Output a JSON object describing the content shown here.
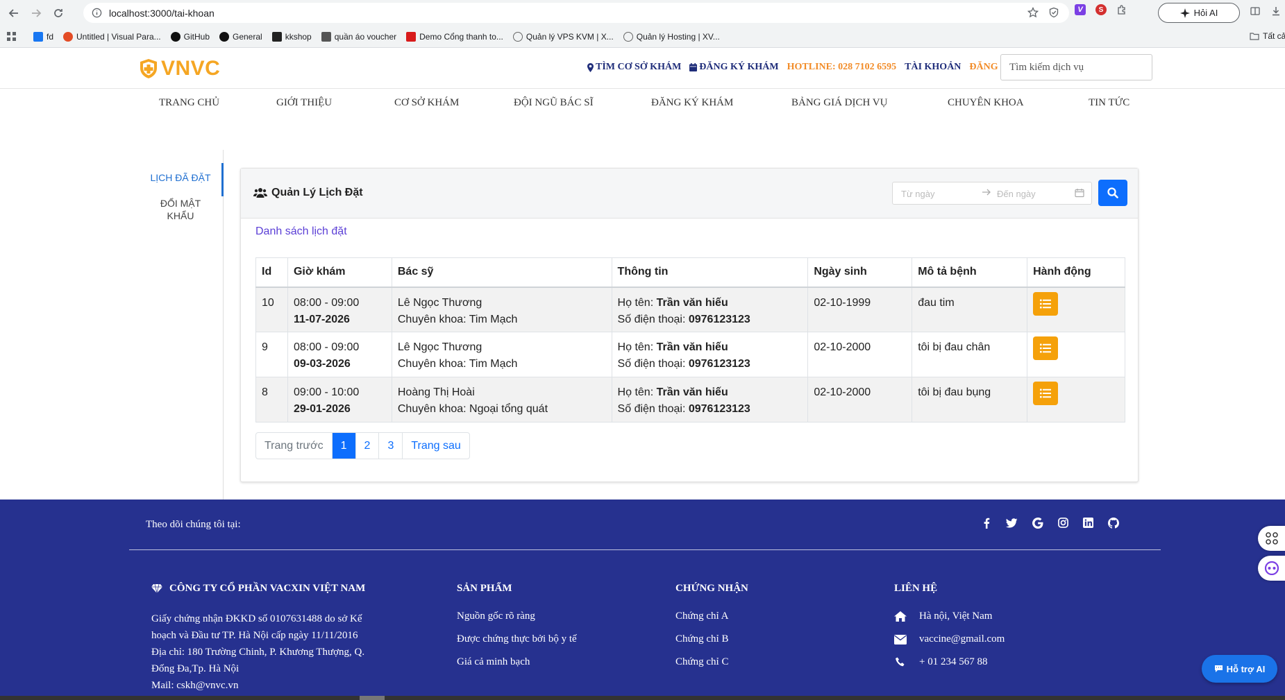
{
  "browser": {
    "url": "localhost:3000/tai-khoan",
    "ask_ai_label": "Hỏi AI",
    "all_bookmarks_label": "Tất cả",
    "bookmarks": [
      {
        "label": "fd",
        "icon": "facebook-icon",
        "color": "#1877f2"
      },
      {
        "label": "Untitled | Visual Para...",
        "icon": "visual-paradigm-icon",
        "color": "#e34c26"
      },
      {
        "label": "GitHub",
        "icon": "github-icon",
        "color": "#111111"
      },
      {
        "label": "General",
        "icon": "github-icon",
        "color": "#111111"
      },
      {
        "label": "kkshop",
        "icon": "kkshop-icon",
        "color": "#222222"
      },
      {
        "label": "quần áo voucher",
        "icon": "voucher-icon",
        "color": "#555555"
      },
      {
        "label": "Demo Cổng thanh to...",
        "icon": "vnpay-icon",
        "color": "#d81b1b"
      },
      {
        "label": "Quản lý VPS KVM | X...",
        "icon": "user-icon",
        "color": "#666666"
      },
      {
        "label": "Quản lý Hosting | XV...",
        "icon": "user-icon",
        "color": "#666666"
      }
    ]
  },
  "header": {
    "logo_text": "VNVC",
    "links": [
      {
        "label": "TÌM CƠ SỞ KHÁM",
        "style": "dark",
        "icon": "map-marker-icon"
      },
      {
        "label": "ĐĂNG KÝ KHÁM",
        "style": "dark",
        "icon": "calendar-icon"
      },
      {
        "label": "HOTLINE: 028 7102 6595",
        "style": "orange"
      },
      {
        "label": "TÀI KHOẢN",
        "style": "dark"
      },
      {
        "label": "ĐĂNG XUẤT",
        "style": "orange"
      }
    ],
    "search_placeholder": "Tìm kiếm dịch vụ"
  },
  "nav": [
    "TRANG CHỦ",
    "GIỚI THIỆU",
    "CƠ SỞ KHÁM",
    "ĐỘI NGŨ BÁC SĨ",
    "ĐĂNG KÝ KHÁM",
    "BẢNG GIÁ DỊCH VỤ",
    "CHUYÊN KHOA",
    "TIN TỨC"
  ],
  "sidebar": {
    "items": [
      "LỊCH ĐÃ ĐẶT",
      "ĐỔI MẬT KHẨU"
    ]
  },
  "card": {
    "title": "Quản Lý Lịch Đặt",
    "from_placeholder": "Từ ngày",
    "to_placeholder": "Đến ngày",
    "list_title": "Danh sách lịch đặt",
    "columns": [
      "Id",
      "Giờ khám",
      "Bác sỹ",
      "Thông tin",
      "Ngày sinh",
      "Mô tả bệnh",
      "Hành động"
    ],
    "name_prefix": "Họ tên: ",
    "phone_prefix": "Số điện thoại: ",
    "specialty_prefix": "Chuyên khoa: ",
    "rows": [
      {
        "id": "10",
        "time": "08:00 - 09:00",
        "date": "11-07-2026",
        "doctor": "Lê Ngọc Thương",
        "specialty": "Tim Mạch",
        "name": "Trần văn hiếu",
        "phone": "0976123123",
        "dob": "02-10-1999",
        "desc": "đau tim"
      },
      {
        "id": "9",
        "time": "08:00 - 09:00",
        "date": "09-03-2026",
        "doctor": "Lê Ngọc Thương",
        "specialty": "Tim Mạch",
        "name": "Trần văn hiếu",
        "phone": "0976123123",
        "dob": "02-10-2000",
        "desc": "tôi bị đau chân"
      },
      {
        "id": "8",
        "time": "09:00 - 10:00",
        "date": "29-01-2026",
        "doctor": "Hoàng Thị Hoài",
        "specialty": "Ngoại tổng quát",
        "name": "Trần văn hiếu",
        "phone": "0976123123",
        "dob": "02-10-2000",
        "desc": "tôi bị đau bụng"
      }
    ],
    "pager": {
      "prev": "Trang trước",
      "pages": [
        "1",
        "2",
        "3"
      ],
      "active": "1",
      "next": "Trang sau"
    }
  },
  "footer": {
    "follow_label": "Theo dõi chúng tôi tại:",
    "social_icons": [
      "facebook-icon",
      "twitter-icon",
      "google-icon",
      "instagram-icon",
      "linkedin-icon",
      "github-icon"
    ],
    "company": {
      "title": "CÔNG TY CỔ PHẦN VACXIN VIỆT NAM",
      "lines": [
        "Giấy chứng nhận ĐKKD số 0107631488 do sở Kế hoạch và Đầu tư TP. Hà Nội cấp ngày 11/11/2016",
        "Địa chỉ: 180 Trường Chinh, P. Khương Thượng, Q. Đống Đa,Tp. Hà Nội",
        "Mail: cskh@vnvc.vn"
      ]
    },
    "products": {
      "title": "SẢN PHẨM",
      "items": [
        "Nguồn gốc rõ ràng",
        "Được chứng thực bởi bộ y tế",
        "Giá cả minh bạch"
      ]
    },
    "certs": {
      "title": "CHỨNG NHẬN",
      "items": [
        "Chứng chỉ A",
        "Chứng chỉ B",
        "Chứng chỉ C"
      ]
    },
    "contact": {
      "title": "LIÊN HỆ",
      "items": [
        {
          "icon": "home-icon",
          "text": "Hà nội, Việt Nam"
        },
        {
          "icon": "envelope-icon",
          "text": "vaccine@gmail.com"
        },
        {
          "icon": "phone-icon",
          "text": "+ 01 234 567 88"
        }
      ]
    },
    "ai_support_label": "Hỗ trợ AI"
  },
  "colors": {
    "brand_orange": "#f5a623",
    "nav_dark": "#1f2d7a",
    "footer_bg": "#26318f",
    "primary": "#0d6efd",
    "action": "#f5a10a"
  }
}
